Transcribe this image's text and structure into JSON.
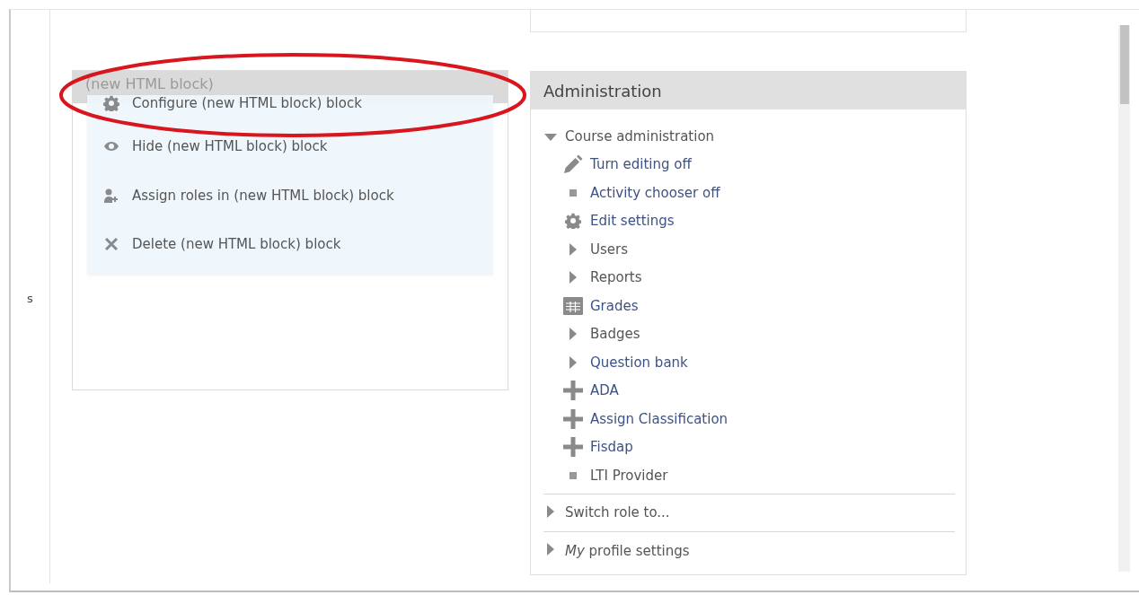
{
  "left_edge_text": "s",
  "html_block": {
    "title": "(new HTML block)"
  },
  "block_menu": {
    "items": [
      {
        "label": "Configure (new HTML block) block",
        "kind": "gear"
      },
      {
        "label": "Hide (new HTML block) block",
        "kind": "eye"
      },
      {
        "label": "Assign roles in (new HTML block) block",
        "kind": "person-add"
      },
      {
        "label": "Delete (new HTML block) block",
        "kind": "cross"
      }
    ]
  },
  "administration": {
    "title": "Administration",
    "sections": [
      {
        "label": "Course administration",
        "expanded": true,
        "children": [
          {
            "label": "Turn editing off",
            "kind": "pencil",
            "link": true
          },
          {
            "label": "Activity chooser off",
            "kind": "bullet",
            "link": true
          },
          {
            "label": "Edit settings",
            "kind": "gear",
            "link": true
          },
          {
            "label": "Users",
            "kind": "branch",
            "link": false,
            "expanded": false
          },
          {
            "label": "Reports",
            "kind": "branch",
            "link": false,
            "expanded": false
          },
          {
            "label": "Grades",
            "kind": "grid",
            "link": true
          },
          {
            "label": "Badges",
            "kind": "branch",
            "link": false,
            "expanded": false
          },
          {
            "label": "Question bank",
            "kind": "branch",
            "link": true,
            "expanded": false
          },
          {
            "label": "ADA",
            "kind": "plus",
            "link": true
          },
          {
            "label": "Assign Classification",
            "kind": "plus",
            "link": true
          },
          {
            "label": "Fisdap",
            "kind": "plus",
            "link": true
          },
          {
            "label": "LTI Provider",
            "kind": "bullet",
            "link": false
          }
        ]
      },
      {
        "label": "Switch role to...",
        "expanded": false
      },
      {
        "label": "*My* profile settings",
        "expanded": false
      }
    ]
  }
}
